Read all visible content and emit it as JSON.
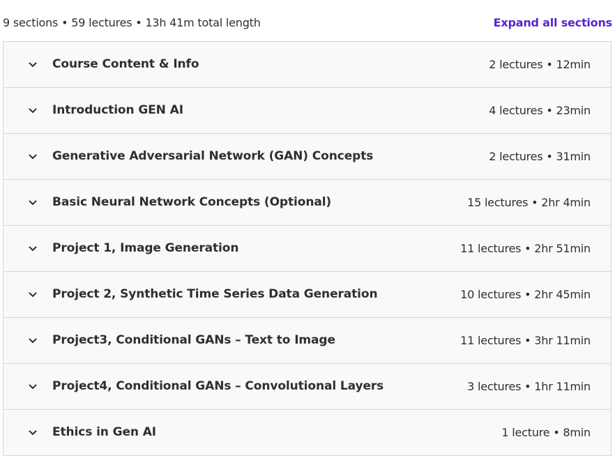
{
  "summary": {
    "text": "9 sections • 59 lectures • 13h 41m total length",
    "expand_label": "Expand all sections"
  },
  "colors": {
    "accent": "#5624d0",
    "text": "#2d2f31",
    "row_background": "#f7f9fa",
    "border": "#d1d7dc"
  },
  "sections": [
    {
      "title": "Course Content & Info",
      "meta": "2 lectures • 12min",
      "icon": "chevron-down-icon"
    },
    {
      "title": "Introduction GEN AI",
      "meta": "4 lectures • 23min",
      "icon": "chevron-down-icon"
    },
    {
      "title": "Generative Adversarial Network (GAN) Concepts",
      "meta": "2 lectures • 31min",
      "icon": "chevron-down-icon"
    },
    {
      "title": "Basic Neural Network Concepts (Optional)",
      "meta": "15 lectures • 2hr 4min",
      "icon": "chevron-down-icon"
    },
    {
      "title": "Project 1, Image Generation",
      "meta": "11 lectures • 2hr 51min",
      "icon": "chevron-down-icon"
    },
    {
      "title": "Project 2, Synthetic Time Series Data Generation",
      "meta": "10 lectures • 2hr 45min",
      "icon": "chevron-down-icon"
    },
    {
      "title": "Project3, Conditional GANs – Text to Image",
      "meta": "11 lectures • 3hr 11min",
      "icon": "chevron-down-icon"
    },
    {
      "title": "Project4, Conditional GANs – Convolutional Layers",
      "meta": "3 lectures • 1hr 11min",
      "icon": "chevron-down-icon"
    },
    {
      "title": "Ethics in Gen AI",
      "meta": "1 lecture • 8min",
      "icon": "chevron-down-icon"
    }
  ]
}
